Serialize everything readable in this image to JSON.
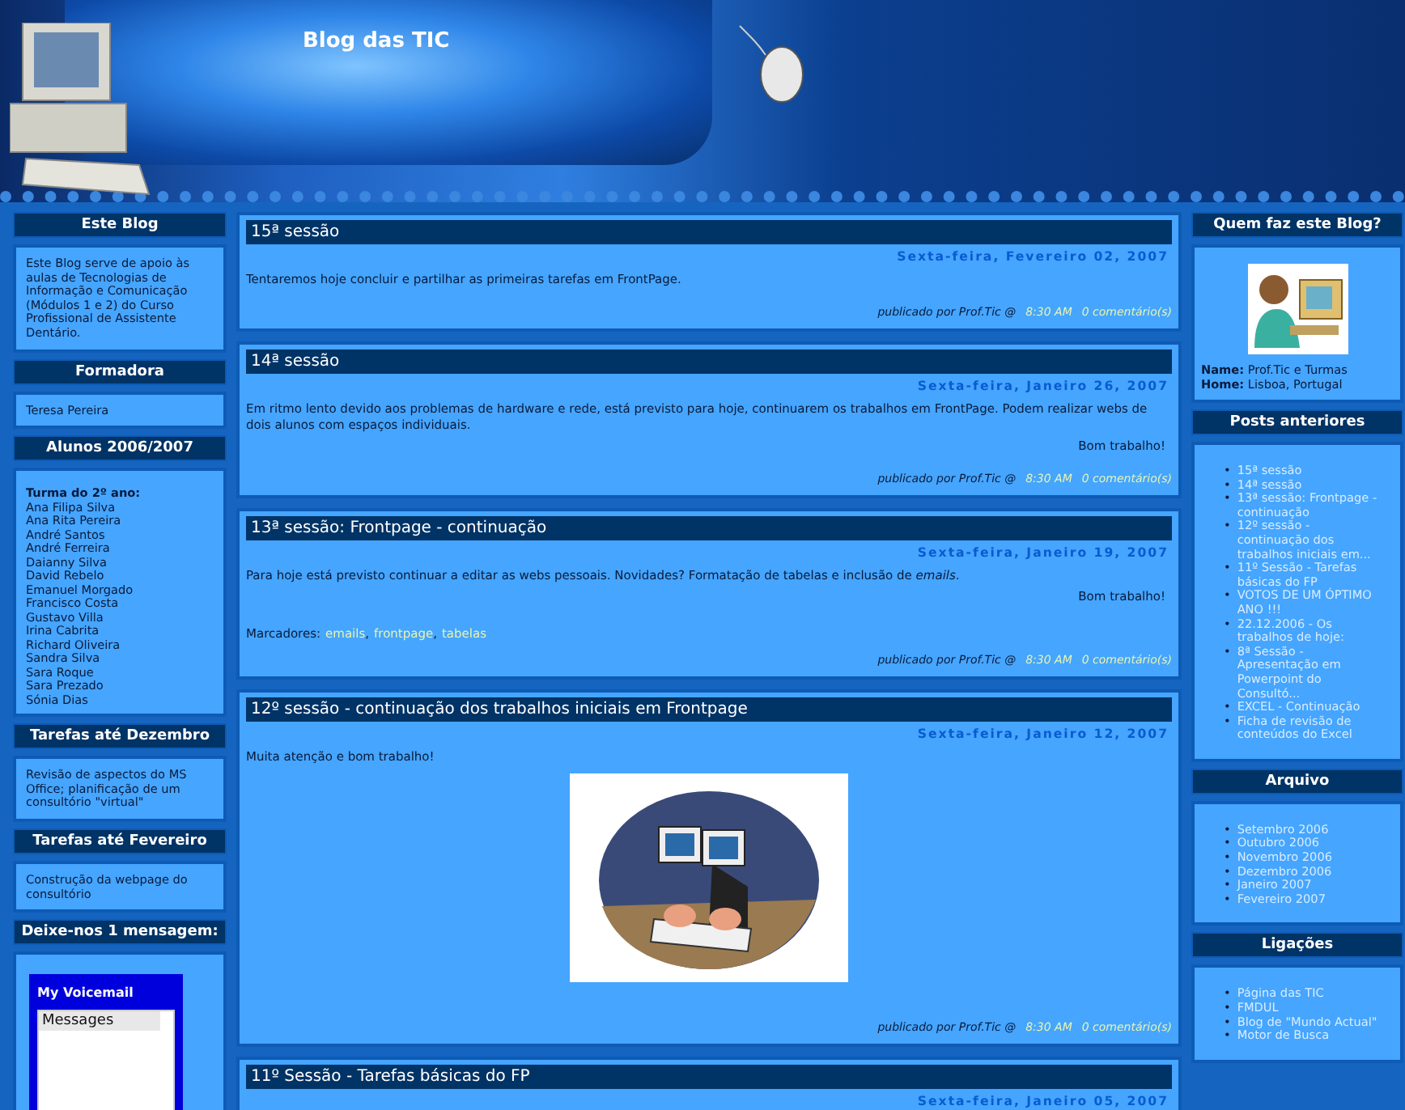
{
  "header": {
    "title": "Blog das TIC"
  },
  "left_sidebar": [
    {
      "kind": "text",
      "title": "Este Blog",
      "text": "Este Blog serve de apoio às aulas de Tecnologias de Informação e Comunicação (Módulos 1 e 2) do Curso Profissional de Assistente Dentário."
    },
    {
      "kind": "text",
      "title": "Formadora",
      "text": "Teresa Pereira"
    },
    {
      "kind": "list",
      "title": "Alunos 2006/2007",
      "heading": "Turma do 2º ano:",
      "items": [
        "Ana Filipa Silva",
        "Ana Rita Pereira",
        "André Santos",
        "André Ferreira",
        "Daianny Silva",
        "David Rebelo",
        "Emanuel Morgado",
        "Francisco Costa",
        "Gustavo Villa",
        "Irina Cabrita",
        "Richard Oliveira",
        "Sandra Silva",
        "Sara Roque",
        "Sara Prezado",
        "Sónia Dias"
      ]
    },
    {
      "kind": "text",
      "title": "Tarefas até Dezembro",
      "text": "Revisão de aspectos do MS Office; planificação de um consultório \"virtual\""
    },
    {
      "kind": "text",
      "title": "Tarefas até Fevereiro",
      "text": "Construção da webpage do consultório"
    },
    {
      "kind": "voicemail",
      "title": "Deixe-nos 1 mensagem:",
      "widget_title": "My Voicemail",
      "list_header": "Messages"
    }
  ],
  "posts": [
    {
      "title": "15ª sessão",
      "date": "Sexta-feira, Fevereiro 02, 2007",
      "paragraphs": [
        {
          "kind": "text",
          "text": "Tentaremos hoje concluir e partilhar as primeiras tarefas em FrontPage."
        }
      ],
      "byline": "publicado por Prof.Tic @",
      "time": "8:30 AM",
      "comments": "0 comentário(s)"
    },
    {
      "title": "14ª sessão",
      "date": "Sexta-feira, Janeiro 26, 2007",
      "paragraphs": [
        {
          "kind": "text",
          "text": "Em ritmo lento devido aos problemas de hardware e rede, está previsto para hoje, continuarem os trabalhos em FrontPage. Podem realizar webs de dois alunos com espaços individuais."
        },
        {
          "kind": "signoff",
          "text": "Bom trabalho!"
        }
      ],
      "byline": "publicado por Prof.Tic @",
      "time": "8:30 AM",
      "comments": "0 comentário(s)"
    },
    {
      "title": "13ª sessão: Frontpage - continuação",
      "date": "Sexta-feira, Janeiro 19, 2007",
      "paragraphs": [
        {
          "kind": "text",
          "text": "Para hoje está previsto continuar a editar as webs pessoais. Novidades? Formatação de tabelas e inclusão de *emails*."
        },
        {
          "kind": "signoff",
          "text": "Bom trabalho!"
        }
      ],
      "labels_prefix": "Marcadores:",
      "label_separator": ",",
      "labels": [
        "emails",
        "frontpage",
        "tabelas"
      ],
      "byline": "publicado por Prof.Tic @",
      "time": "8:30 AM",
      "comments": "0 comentário(s)"
    },
    {
      "title": "12º sessão - continuação dos trabalhos iniciais em Frontpage",
      "date": "Sexta-feira, Janeiro 12, 2007",
      "paragraphs": [
        {
          "kind": "text",
          "text": "Muita atenção e bom trabalho!"
        },
        {
          "kind": "image"
        }
      ],
      "byline": "publicado por Prof.Tic @",
      "time": "8:30 AM",
      "comments": "0 comentário(s)"
    },
    {
      "title": "11º Sessão - Tarefas básicas do FP",
      "date": "Sexta-feira, Janeiro 05, 2007"
    }
  ],
  "right_sidebar": [
    {
      "kind": "profile",
      "title": "Quem faz este Blog?",
      "name_label": "Name:",
      "name": "Prof.Tic e Turmas",
      "home_label": "Home:",
      "home": "Lisboa, Portugal"
    },
    {
      "kind": "links",
      "title": "Posts anteriores",
      "bullet": "•",
      "items": [
        "15ª sessão",
        "14ª sessão",
        "13ª sessão: Frontpage - continuação",
        "12º sessão - continuação dos trabalhos iniciais em...",
        "11º Sessão - Tarefas básicas do FP",
        "VOTOS DE UM ÓPTIMO ANO !!!",
        "22.12.2006 - Os trabalhos de hoje:",
        "8ª Sessão - Apresentação em Powerpoint do Consultó...",
        "EXCEL - Continuação",
        "Ficha de revisão de conteúdos do Excel"
      ]
    },
    {
      "kind": "links",
      "title": "Arquivo",
      "bullet": "•",
      "items": [
        "Setembro 2006",
        "Outubro 2006",
        "Novembro 2006",
        "Dezembro 2006",
        "Janeiro 2007",
        "Fevereiro 2007"
      ]
    },
    {
      "kind": "links",
      "title": "Ligações",
      "bullet": "•",
      "items": [
        "Página das TIC",
        "FMDUL",
        "Blog de \"Mundo Actual\"",
        "Motor de Busca"
      ]
    }
  ]
}
